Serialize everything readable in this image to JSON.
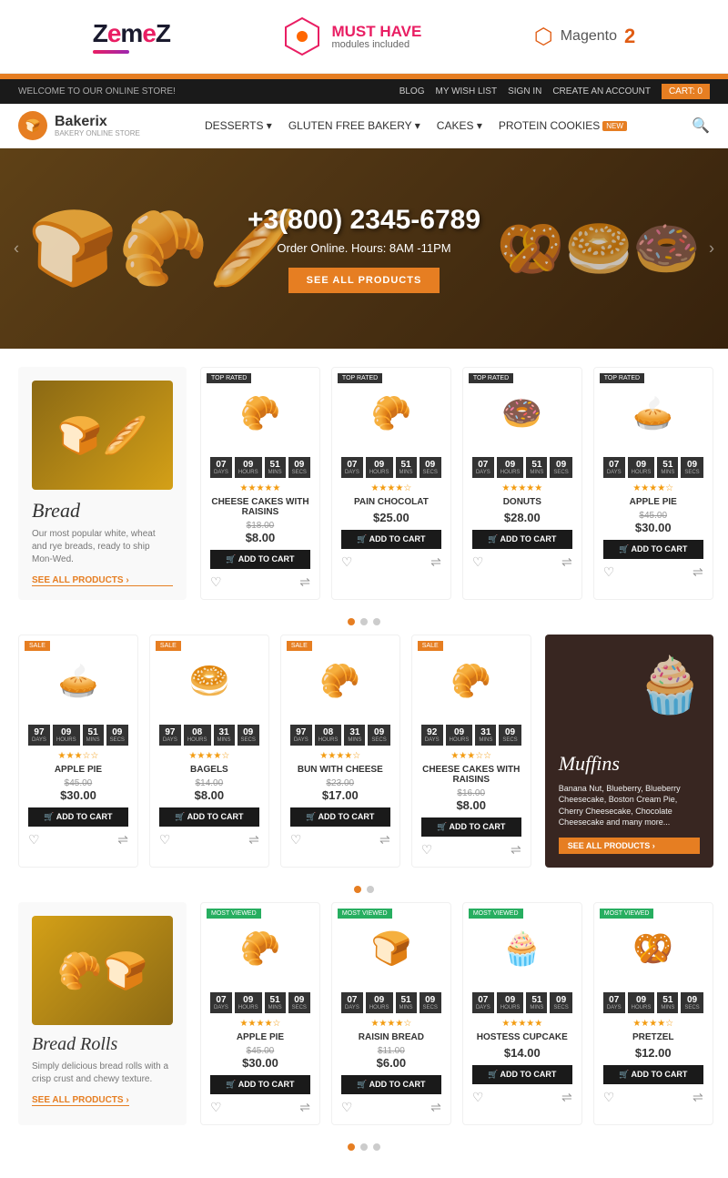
{
  "badges": {
    "zemes": "ZemeZ",
    "must_have_line1": "MUST HAVE",
    "must_have_line2": "modules included",
    "magento_text": "Magento",
    "magento_num": "2"
  },
  "store_header": {
    "welcome": "WELCOME TO OUR ONLINE STORE!",
    "blog": "BLOG",
    "wishlist": "MY WISH LIST",
    "signin": "SIGN IN",
    "create_account": "CREATE AN ACCOUNT",
    "cart": "CART: 0"
  },
  "main_nav": {
    "brand": "Bakerix",
    "brand_sub": "BAKERY ONLINE STORE",
    "menu_items": [
      "DESSERTS",
      "GLUTEN FREE BAKERY",
      "CAKES",
      "PROTEIN COOKIES"
    ],
    "protein_badge": "NEW"
  },
  "hero": {
    "phone": "+3(800) 2345-6789",
    "subtitle": "Order Online. Hours: 8AM -11PM",
    "button": "SEE ALL PRODUCTS"
  },
  "featured_category": {
    "title": "Bread",
    "desc": "Our most popular white, wheat and rye breads, ready to ship Mon-Wed.",
    "link": "SEE ALL PRODUCTS ›"
  },
  "products_row1": [
    {
      "badge": "TOP RATED",
      "timer": {
        "days": "07",
        "hours": "09",
        "mins": "51",
        "secs": "09"
      },
      "stars": "★★★★★",
      "name": "CHEESE CAKES WITH RAISINS",
      "price_old": "$18.00",
      "price": "$8.00",
      "btn": "ADD TO CART",
      "emoji": "🥐"
    },
    {
      "badge": "TOP RATED",
      "timer": {
        "days": "07",
        "hours": "09",
        "mins": "51",
        "secs": "09"
      },
      "stars": "★★★★☆",
      "name": "PAIN CHOCOLAT",
      "price_old": "",
      "price": "$25.00",
      "btn": "ADD TO CART",
      "emoji": "🥐"
    },
    {
      "badge": "TOP RATED",
      "timer": {
        "days": "07",
        "hours": "09",
        "mins": "51",
        "secs": "09"
      },
      "stars": "★★★★★",
      "name": "DONUTS",
      "price_old": "",
      "price": "$28.00",
      "btn": "ADD TO CART",
      "emoji": "🍩"
    },
    {
      "badge": "TOP RATED",
      "timer": {
        "days": "07",
        "hours": "09",
        "mins": "51",
        "secs": "09"
      },
      "stars": "★★★★☆",
      "name": "APPLE PIE",
      "price_old": "$45.00",
      "price": "$30.00",
      "btn": "ADD TO CART",
      "emoji": "🥧"
    }
  ],
  "products_row2": [
    {
      "badge": "SALE",
      "timer": {
        "days": "97",
        "hours": "09",
        "mins": "51",
        "secs": "09"
      },
      "stars": "★★★☆☆",
      "name": "APPLE PIE",
      "price_old": "$45.00",
      "price": "$30.00",
      "btn": "ADD TO CART",
      "emoji": "🥧"
    },
    {
      "badge": "SALE",
      "timer": {
        "days": "97",
        "hours": "08",
        "mins": "31",
        "secs": "09"
      },
      "stars": "★★★★☆",
      "name": "BAGELS",
      "price_old": "$14.00",
      "price": "$8.00",
      "btn": "ADD TO CART",
      "emoji": "🥯"
    },
    {
      "badge": "SALE",
      "timer": {
        "days": "97",
        "hours": "08",
        "mins": "31",
        "secs": "09"
      },
      "stars": "★★★★☆",
      "name": "BUN WITH CHEESE",
      "price_old": "$23.00",
      "price": "$17.00",
      "btn": "ADD TO CART",
      "emoji": "🥐"
    },
    {
      "badge": "SALE",
      "timer": {
        "days": "92",
        "hours": "09",
        "mins": "31",
        "secs": "09"
      },
      "stars": "★★★☆☆",
      "name": "CHEESE CAKES WITH RAISINS",
      "price_old": "$16.00",
      "price": "$8.00",
      "btn": "ADD TO CART",
      "emoji": "🥐"
    }
  ],
  "muffins_promo": {
    "title": "Muffins",
    "desc": "Banana Nut, Blueberry, Blueberry Cheesecake, Boston Cream Pie, Cherry Cheesecake, Chocolate Cheesecake and many more...",
    "link": "SEE ALL PRODUCTS ›"
  },
  "bread_rolls": {
    "title": "Bread Rolls",
    "desc": "Simply delicious bread rolls with a crisp crust and chewy texture.",
    "link": "SEE ALL PRODUCTS ›"
  },
  "products_row3": [
    {
      "badge": "MOST VIEWED",
      "timer": {
        "days": "07",
        "hours": "09",
        "mins": "51",
        "secs": "09"
      },
      "stars": "★★★★☆",
      "name": "APPLE PIE",
      "price_old": "$45.00",
      "price": "$30.00",
      "btn": "ADD TO CART",
      "emoji": "🥐"
    },
    {
      "badge": "MOST VIEWED",
      "timer": {
        "days": "07",
        "hours": "09",
        "mins": "51",
        "secs": "09"
      },
      "stars": "★★★★☆",
      "name": "RAISIN BREAD",
      "price_old": "$11.00",
      "price": "$6.00",
      "btn": "ADD TO CART",
      "emoji": "🍞"
    },
    {
      "badge": "MOST VIEWED",
      "timer": {
        "days": "07",
        "hours": "09",
        "mins": "51",
        "secs": "09"
      },
      "stars": "★★★★★",
      "name": "HOSTESS CUPCAKE",
      "price_old": "",
      "price": "$14.00",
      "btn": "ADD TO CART",
      "emoji": "🧁"
    },
    {
      "badge": "MOST VIEWED",
      "timer": {
        "days": "07",
        "hours": "09",
        "mins": "51",
        "secs": "09"
      },
      "stars": "★★★★☆",
      "name": "PRETZEL",
      "price_old": "",
      "price": "$12.00",
      "btn": "ADD TO CART",
      "emoji": "🥨"
    }
  ]
}
